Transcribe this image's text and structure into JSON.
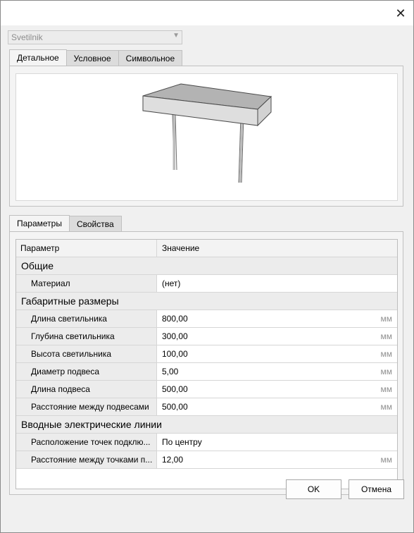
{
  "family_select": {
    "value": "Svetilnik"
  },
  "view_tabs": [
    {
      "label": "Детальное",
      "active": true
    },
    {
      "label": "Условное",
      "active": false
    },
    {
      "label": "Символьное",
      "active": false
    }
  ],
  "params_tabs": [
    {
      "label": "Параметры",
      "active": true
    },
    {
      "label": "Свойства",
      "active": false
    }
  ],
  "grid": {
    "headers": {
      "param": "Параметр",
      "value": "Значение"
    },
    "groups": [
      {
        "title": "Общие",
        "rows": [
          {
            "name": "Материал",
            "value": "(нет)",
            "unit": ""
          }
        ]
      },
      {
        "title": "Габаритные размеры",
        "rows": [
          {
            "name": "Длина светильника",
            "value": "800,00",
            "unit": "мм"
          },
          {
            "name": "Глубина светильника",
            "value": "300,00",
            "unit": "мм"
          },
          {
            "name": "Высота светильника",
            "value": "100,00",
            "unit": "мм"
          },
          {
            "name": "Диаметр подвеса",
            "value": "5,00",
            "unit": "мм"
          },
          {
            "name": "Длина подвеса",
            "value": "500,00",
            "unit": "мм"
          },
          {
            "name": "Расстояние между подвесами",
            "value": "500,00",
            "unit": "мм"
          }
        ]
      },
      {
        "title": "Вводные электрические линии",
        "rows": [
          {
            "name": "Расположение точек подклю...",
            "value": "По центру",
            "unit": ""
          },
          {
            "name": "Расстояние между точками п...",
            "value": "12,00",
            "unit": "мм"
          }
        ]
      }
    ]
  },
  "buttons": {
    "ok": "OK",
    "cancel": "Отмена"
  },
  "icons": {
    "close": "close-icon",
    "dropdown": "chevron-down-icon"
  }
}
